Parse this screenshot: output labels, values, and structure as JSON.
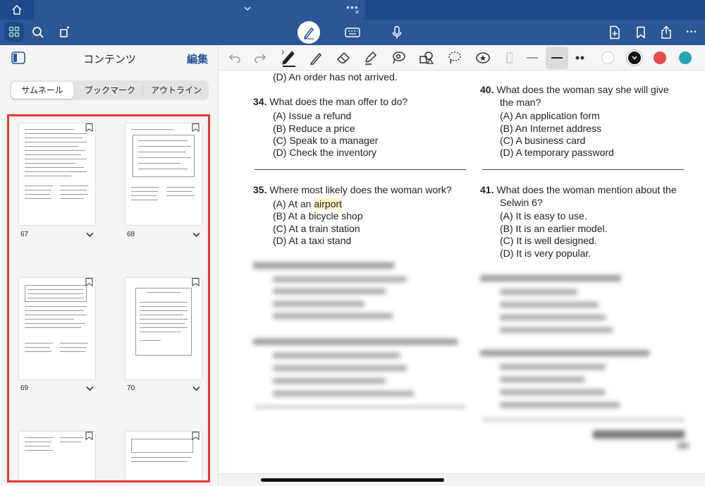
{
  "topbar": {
    "home_icon": "home-icon",
    "dots": "•••",
    "close": "×"
  },
  "toolbar": {
    "icons": [
      "grid-icon",
      "search-icon",
      "stamp-icon",
      "pen-mode-icon",
      "keyboard-icon",
      "microphone-icon",
      "add-page-icon",
      "bookmark-icon",
      "share-icon",
      "more-icon"
    ],
    "more_label": "···",
    "accent": "#2b5797"
  },
  "sidebar": {
    "title": "コンテンツ",
    "edit": "編集",
    "tabs": [
      "サムネール",
      "ブックマーク",
      "アウトライン"
    ],
    "selected_tab": "サムネール",
    "thumbnails": [
      {
        "page": "67"
      },
      {
        "page": "68"
      },
      {
        "page": "69"
      },
      {
        "page": "70"
      }
    ],
    "highlight_color": "#e53935"
  },
  "annotation_toolbar": {
    "tools": [
      "undo-icon",
      "redo-icon",
      "pen-icon",
      "pencil-icon",
      "eraser-icon",
      "highlighter-icon",
      "lasso-icon",
      "shape-icon",
      "lasso-select-icon",
      "sticker-icon"
    ],
    "thickness": [
      "thin",
      "medium",
      "dotted"
    ],
    "selected_thickness": "medium",
    "colors": [
      "#ffffff",
      "#111111",
      "#e84a4a",
      "#26a6b5"
    ],
    "selected_color": "#111111"
  },
  "document": {
    "top_partial": "(D) An order has not arrived.",
    "questions": [
      {
        "num": "34.",
        "text": "What does the man offer to do?",
        "options": [
          "(A) Issue a refund",
          "(B) Reduce a price",
          "(C) Speak to a manager",
          "(D) Check the inventory"
        ]
      },
      {
        "num": "40.",
        "text_line1": "What does the woman say she will give",
        "text_line2": "the man?",
        "options": [
          "(A) An application form",
          "(B) An Internet address",
          "(C) A business card",
          "(D) A temporary password"
        ]
      },
      {
        "num": "35.",
        "text": "Where most likely does the woman work?",
        "options_prefix": "(A) At an ",
        "options_highlight": "airport",
        "options": [
          "(B) At a bicycle shop",
          "(C) At a train station",
          "(D) At a taxi stand"
        ]
      },
      {
        "num": "41.",
        "text_line1": "What does the woman mention about the",
        "text_line2": "Selwin 6?",
        "options": [
          "(A) It is easy to use.",
          "(B) It is an earlier model.",
          "(C) It is well designed.",
          "(D) It is very popular."
        ]
      }
    ]
  }
}
